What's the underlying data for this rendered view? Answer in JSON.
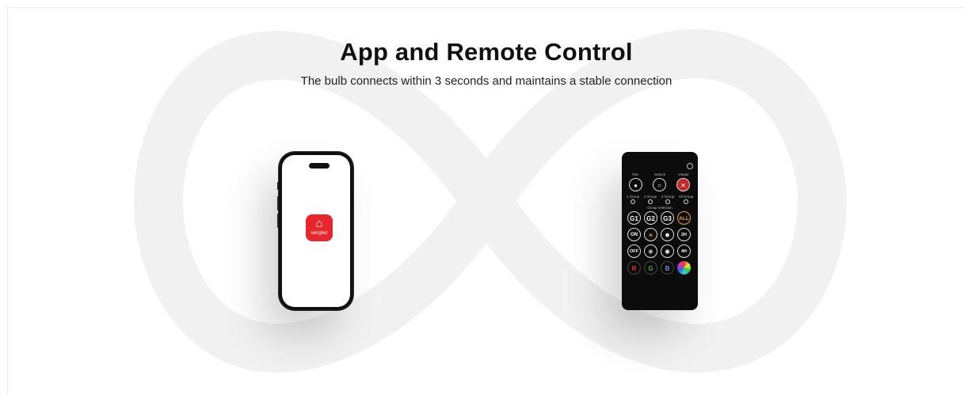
{
  "heading": {
    "title": "App and Remote Control",
    "subtitle": "The bulb connects within 3 seconds and maintains a stable connection"
  },
  "phone": {
    "app_name": "sengled",
    "app_icon": "house-icon",
    "app_color": "#e8262b"
  },
  "remote": {
    "top_labels": [
      "Pair",
      "Search",
      "Unpair"
    ],
    "mode_labels": [
      "1 Group",
      "2 Group",
      "3 Group",
      "All Group"
    ],
    "group_label": "Group selection",
    "group_buttons": [
      "G1",
      "G2",
      "G3",
      "ALL"
    ],
    "row_on": [
      "ON",
      "",
      "",
      "2H"
    ],
    "row_off": [
      "OFF",
      "",
      "",
      "4H"
    ],
    "rgb": [
      "R",
      "G",
      "B"
    ],
    "all_color": "#e8a43a",
    "r_color": "#e33333",
    "g_color": "#3cb043",
    "b_color": "#3366dd"
  }
}
